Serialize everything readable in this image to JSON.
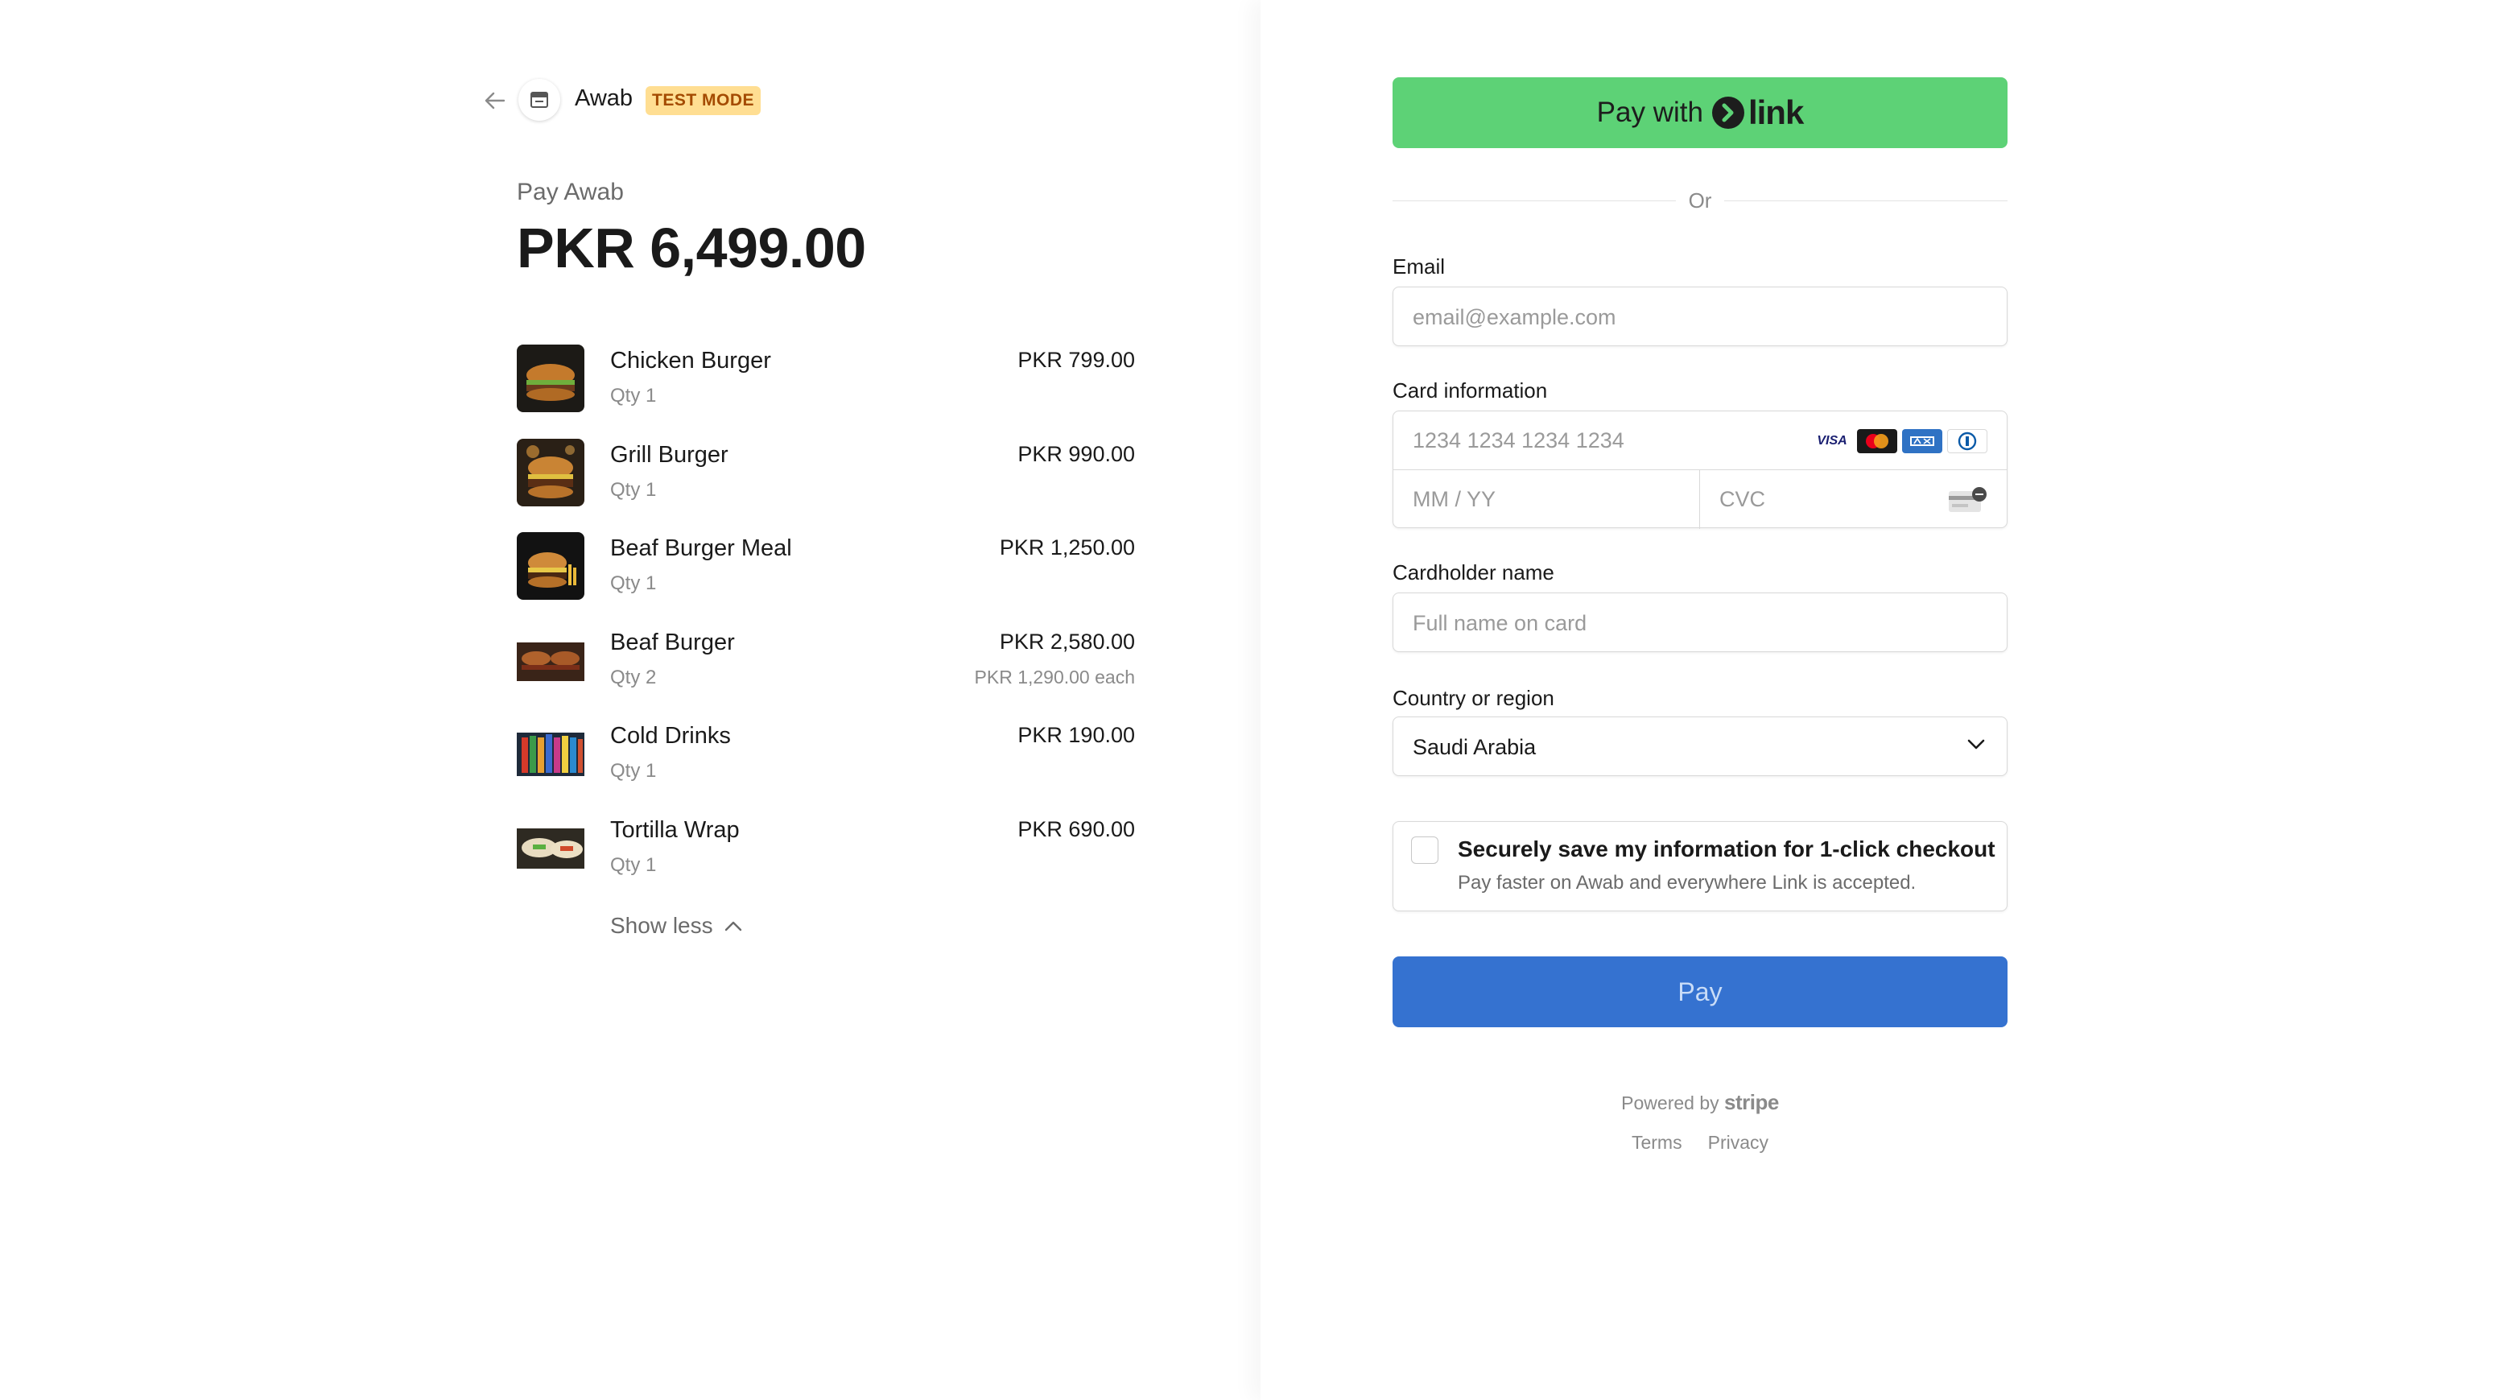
{
  "merchant": {
    "name": "Awab",
    "badge": "TEST MODE"
  },
  "summary": {
    "pay_label": "Pay Awab",
    "amount": "PKR 6,499.00"
  },
  "items": [
    {
      "name": "Chicken Burger",
      "qty": "Qty 1",
      "price": "PKR 799.00",
      "each": ""
    },
    {
      "name": "Grill Burger",
      "qty": "Qty 1",
      "price": "PKR 990.00",
      "each": ""
    },
    {
      "name": "Beaf Burger Meal",
      "qty": "Qty 1",
      "price": "PKR 1,250.00",
      "each": ""
    },
    {
      "name": "Beaf Burger",
      "qty": "Qty 2",
      "price": "PKR 2,580.00",
      "each": "PKR 1,290.00 each"
    },
    {
      "name": "Cold Drinks",
      "qty": "Qty 1",
      "price": "PKR 190.00",
      "each": ""
    },
    {
      "name": "Tortilla Wrap",
      "qty": "Qty 1",
      "price": "PKR 690.00",
      "each": ""
    }
  ],
  "show_less": "Show less",
  "link_button": {
    "prefix": "Pay with",
    "brand": "link"
  },
  "divider_text": "Or",
  "email": {
    "label": "Email",
    "placeholder": "email@example.com"
  },
  "card": {
    "label": "Card information",
    "number_placeholder": "1234 1234 1234 1234",
    "expiry_placeholder": "MM / YY",
    "cvc_placeholder": "CVC",
    "brands": [
      "VISA",
      "mastercard-icon",
      "amex-icon",
      "diners-icon"
    ]
  },
  "cardholder": {
    "label": "Cardholder name",
    "placeholder": "Full name on card"
  },
  "country": {
    "label": "Country or region",
    "value": "Saudi Arabia"
  },
  "save_info": {
    "title": "Securely save my information for 1-click checkout",
    "subtitle": "Pay faster on Awab and everywhere Link is accepted."
  },
  "pay_button": "Pay",
  "footer": {
    "powered_by": "Powered by",
    "brand": "stripe",
    "terms": "Terms",
    "privacy": "Privacy"
  },
  "colors": {
    "link_green": "#5dd276",
    "pay_blue": "#3572d0",
    "badge_bg": "#ffde92",
    "badge_text": "#a44b00"
  }
}
